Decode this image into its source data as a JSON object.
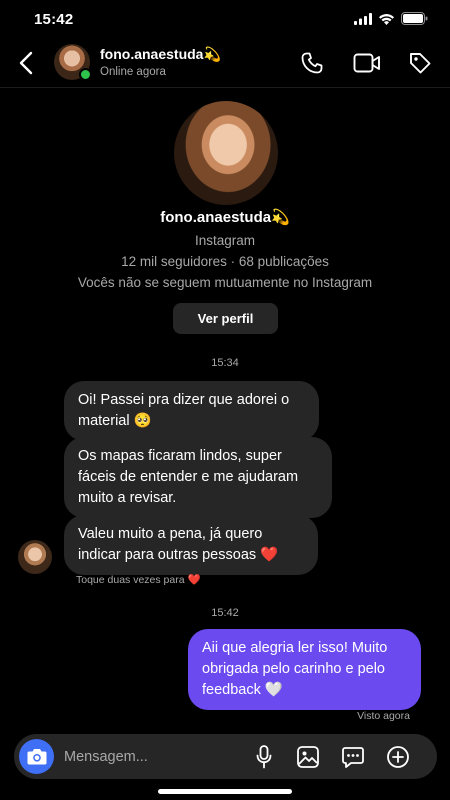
{
  "status_bar": {
    "time": "15:42"
  },
  "header": {
    "username": "fono.anaestuda💫",
    "status": "Online agora",
    "icons": [
      "back-arrow-icon",
      "phone-icon",
      "video-camera-icon",
      "tag-icon"
    ]
  },
  "profile": {
    "name": "fono.anaestuda💫",
    "platform": "Instagram",
    "stats": "12 mil seguidores · 68 publicações",
    "mutual": "Vocês não se seguem mutuamente no Instagram",
    "view_profile_label": "Ver perfil"
  },
  "messages": {
    "time_1": "15:34",
    "incoming": [
      "Oi! Passei pra dizer que adorei o material 🥺",
      "Os mapas ficaram lindos, super fáceis de entender e me ajudaram muito a revisar.",
      "Valeu muito a pena, já quero indicar para outras pessoas ❤️"
    ],
    "hint": "Toque duas vezes para ❤️",
    "time_2": "15:42",
    "outgoing": "Aii que alegria ler isso! Muito obrigada pelo carinho e pelo feedback 🤍",
    "seen": "Visto agora"
  },
  "composer": {
    "placeholder": "Mensagem...",
    "icons": [
      "camera-icon",
      "microphone-icon",
      "image-icon",
      "sticker-icon",
      "plus-icon"
    ]
  },
  "colors": {
    "background": "#000000",
    "incoming_bubble": "#262626",
    "outgoing_bubble": "#6b4bf0",
    "camera_button": "#3f6ff5",
    "online": "#2ec34a"
  }
}
